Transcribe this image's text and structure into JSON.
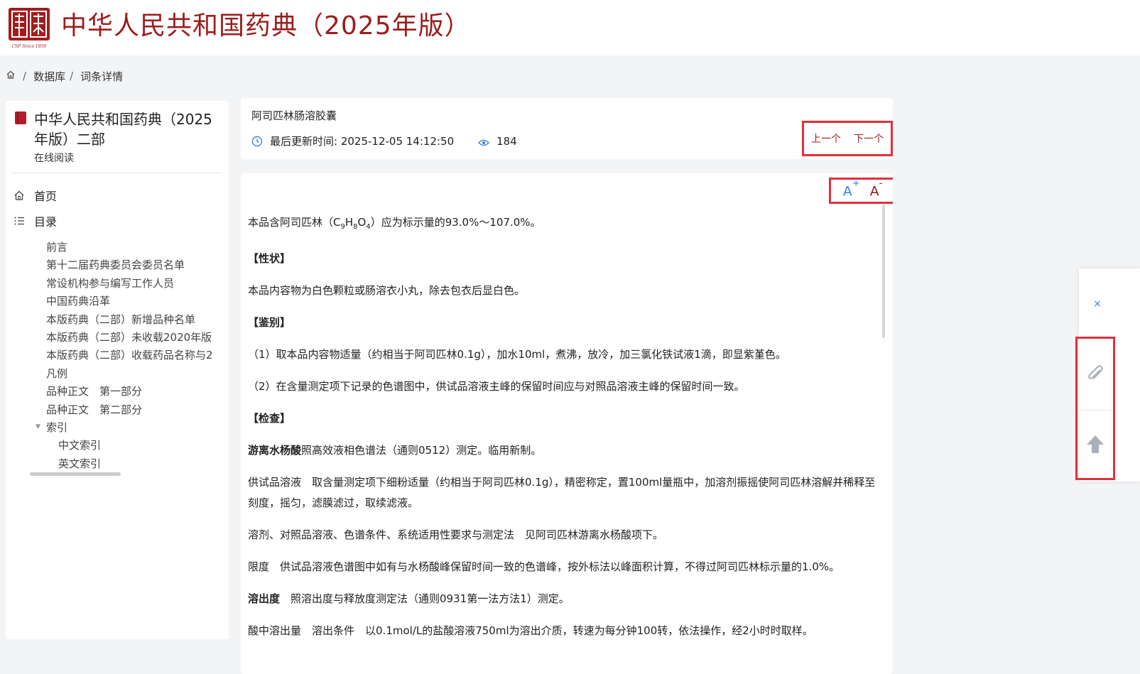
{
  "header": {
    "logo_caption": "ChP Since 1950",
    "site_title": "中华人民共和国药典（2025年版）"
  },
  "breadcrumb": {
    "home_icon": "home-icon",
    "items": [
      "数据库",
      "词条详情"
    ],
    "separator": "/"
  },
  "sidebar": {
    "book_title": "中华人民共和国药典（2025年版）二部",
    "book_sub": "在线阅读",
    "nav": [
      {
        "icon": "home-icon",
        "label": "首页"
      },
      {
        "icon": "list-icon",
        "label": "目录"
      }
    ],
    "toc": [
      "前言",
      "第十二届药典委员会委员名单",
      "常设机构参与编写工作人员",
      "中国药典沿革",
      "本版药典（二部）新增品种名单",
      "本版药典（二部）未收载2020年版",
      "本版药典（二部）收载药品名称与2",
      "凡例",
      "品种正文　第一部分",
      "品种正文　第二部分",
      "索引"
    ],
    "toc_children": [
      "中文索引",
      "英文索引"
    ]
  },
  "meta": {
    "entry_title": "阿司匹林肠溶胶囊",
    "updated_label": "最后更新时间: 2025-12-05 14:12:50",
    "views": "184",
    "prev_label": "上一个",
    "next_label": "下一个"
  },
  "content": {
    "font_inc": "A",
    "font_inc_sup": "+",
    "font_dec": "A",
    "font_dec_sup": "-",
    "p1_pre": "本品含阿司匹林（C",
    "p1_sub1": "9",
    "p1_mid1": "H",
    "p1_sub2": "8",
    "p1_mid2": "O",
    "p1_sub3": "4",
    "p1_post": "）应为标示量的93.0%～107.0%。",
    "h_xingzhuang": "【性状】",
    "p_xingzhuang": "本品内容物为白色颗粒或肠溶衣小丸，除去包衣后显白色。",
    "h_jianbie": "【鉴别】",
    "p_jianbie1": "（1）取本品内容物适量（约相当于阿司匹林0.1g），加水10ml，煮沸，放冷，加三氯化铁试液1滴，即显紫堇色。",
    "p_jianbie2": "（2）在含量测定项下记录的色谱图中，供试品溶液主峰的保留时间应与对照品溶液主峰的保留时间一致。",
    "h_jiancha": "【检查】",
    "p_youli_bold": "游离水杨酸",
    "p_youli_rest": "照高效液相色谱法（通则0512）测定。临用新制。",
    "p_gongshi": "供试品溶液　取含量测定项下细粉适量（约相当于阿司匹林0.1g），精密称定，置100ml量瓶中，加溶剂振摇使阿司匹林溶解并稀释至刻度，摇匀，滤膜滤过，取续滤液。",
    "p_rongji": "溶剂、对照品溶液、色谱条件、系统适用性要求与测定法　见阿司匹林游离水杨酸项下。",
    "p_xiandu": "限度　供试品溶液色谱图中如有与水杨酸峰保留时间一致的色谱峰，按外标法以峰面积计算，不得过阿司匹林标示量的1.0%。",
    "p_rongchu_bold": "溶出度",
    "p_rongchu_rest": "　照溶出度与释放度测定法（通则0931第一法方法1）测定。",
    "p_suanzhong": "酸中溶出量　溶出条件　以0.1mol/L的盐酸溶液750ml为溶出介质，转速为每分钟100转，依法操作，经2小时时取样。"
  },
  "float_panel": {
    "close": "×",
    "icons": [
      "paperclip-icon",
      "arrow-up-icon"
    ]
  }
}
